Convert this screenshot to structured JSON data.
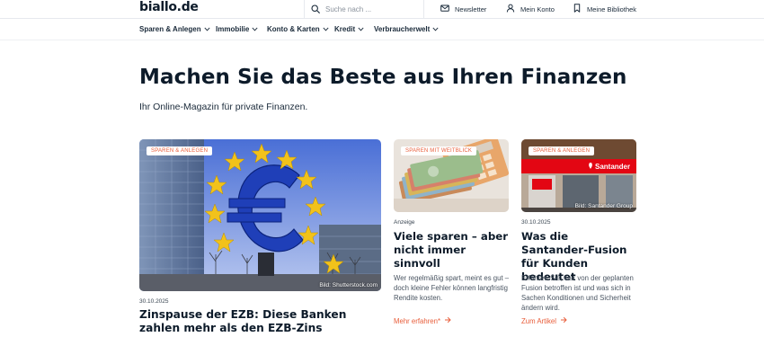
{
  "header": {
    "logo": "biallo.de",
    "search_placeholder": "Suche nach ...",
    "links": {
      "newsletter": "Newsletter",
      "account": "Mein Konto",
      "library": "Meine Bibliothek"
    }
  },
  "nav": {
    "items": [
      {
        "label": "Sparen & Anlegen"
      },
      {
        "label": "Immobilie"
      },
      {
        "label": "Konto & Karten"
      },
      {
        "label": "Kredit"
      },
      {
        "label": "Verbraucherwelt"
      }
    ]
  },
  "hero": {
    "title": "Machen Sie das Beste aus Ihren Finanzen",
    "subtitle": "Ihr Online-Magazin für private Finanzen."
  },
  "cards": [
    {
      "badge": "Sparen & Anlegen",
      "credit": "Bild: Shutterstock.com",
      "meta": "30.10.2025",
      "title": "Zinspause der EZB: Diese Banken zahlen mehr als den EZB-Zins"
    },
    {
      "badge": "Sparen mit Weitblick",
      "meta": "Anzeige",
      "title": "Viele sparen – aber nicht immer sinnvoll",
      "text": "Wer regelmäßig spart, meint es gut – doch kleine Fehler können langfristig Rendite kosten.",
      "more": "Mehr erfahren*"
    },
    {
      "badge": "Sparen & Anlegen",
      "credit": "Bild: Santander Group",
      "brand": "Santander",
      "meta": "30.10.2025",
      "title": "Was die Santander-Fusion für Kunden bedeutet",
      "text": "Erfahren Sie, wer von der geplanten Fusion betroffen ist und was sich in Sachen Konditionen und Sicherheit ändern wird.",
      "more": "Zum Artikel"
    }
  ],
  "colors": {
    "accent": "#e85d3a",
    "text": "#0d1b2a",
    "santander_red": "#e30613"
  },
  "icons": [
    "search-icon",
    "mail-icon",
    "user-icon",
    "bookmark-icon",
    "chevron-down-icon",
    "arrow-right-icon"
  ]
}
